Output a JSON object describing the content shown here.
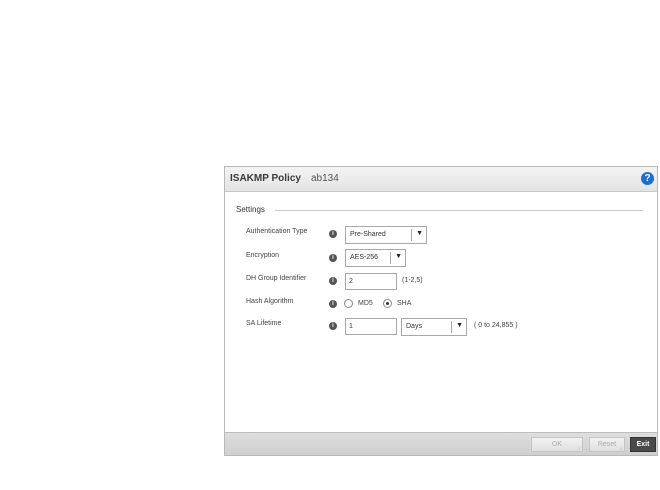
{
  "dialog": {
    "title": "ISAKMP Policy",
    "policy_name": "ab134",
    "help_icon": "?",
    "section": "Settings"
  },
  "fields": {
    "auth_type": {
      "label": "Authentication Type",
      "value": "Pre-Shared"
    },
    "encryption": {
      "label": "Encryption",
      "value": "AES-256"
    },
    "dh_group": {
      "label": "DH Group Identifier",
      "value": "2",
      "hint": "(1-2,5)"
    },
    "hash": {
      "label": "Hash Algorithm",
      "options": [
        "MD5",
        "SHA"
      ],
      "selected": "SHA"
    },
    "sa_lifetime": {
      "label": "SA Lifetime",
      "value": "1",
      "unit": "Days",
      "hint": "( 0 to 24,855 )"
    }
  },
  "info_icon": "i",
  "dropdown_arrow": "▼",
  "footer": {
    "ok_label": "OK",
    "reset_label": "Reset",
    "exit_label": "Exit"
  },
  "colors": {
    "help_icon": "#1b6fd1",
    "exit_button": "#4a4a4a"
  }
}
